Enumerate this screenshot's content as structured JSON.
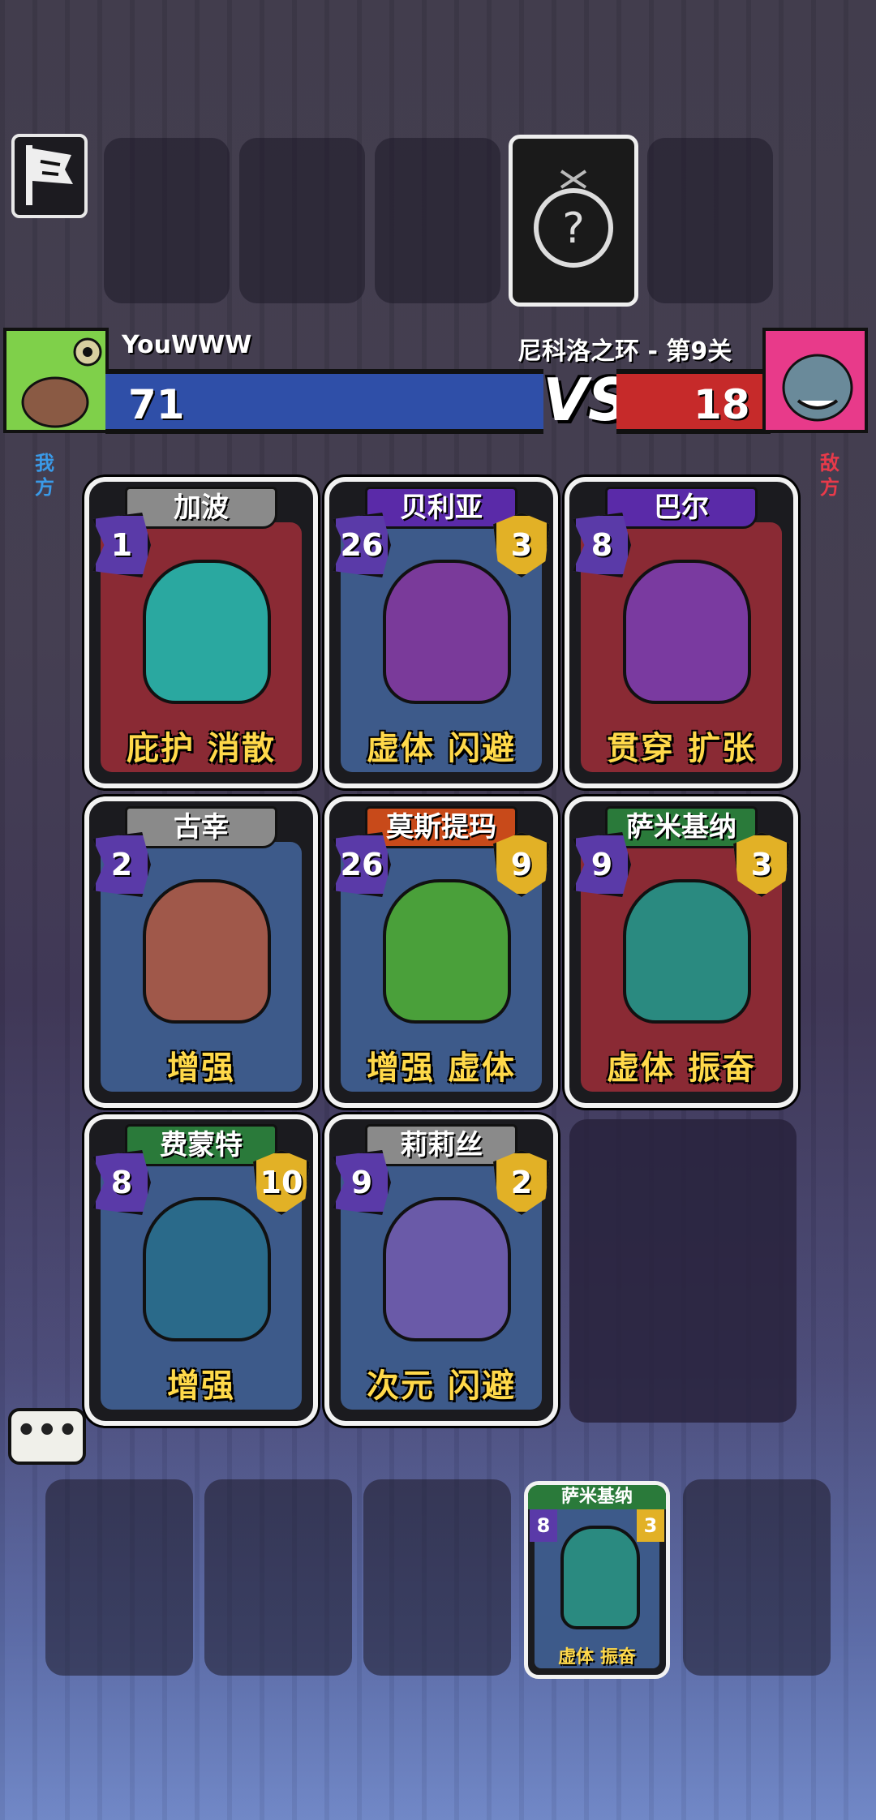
{
  "player": {
    "name": "YouWWW",
    "hp": "71",
    "side_label": "我方",
    "color": "#2f4fa8"
  },
  "enemy": {
    "name": "尼科洛之环 - 第9关",
    "hp": "18",
    "side_label": "敌方",
    "color": "#c62a2a"
  },
  "vs_label": "VS",
  "chat_label": "•••",
  "cards": [
    {
      "name": "加波",
      "attack": "1",
      "defense": "",
      "keywords": "庇护  消散",
      "banner": "#8a8a8a",
      "art": "#8a2a34",
      "monster": "#2aa8a0"
    },
    {
      "name": "贝利亚",
      "attack": "26",
      "defense": "3",
      "keywords": "虚体  闪避",
      "banner": "#5a2aa8",
      "art": "#3d5a8a",
      "monster": "#7a3a9a"
    },
    {
      "name": "巴尔",
      "attack": "8",
      "defense": "",
      "keywords": "贯穿  扩张",
      "banner": "#5a2aa8",
      "art": "#8a2a34",
      "monster": "#7a3aa0"
    },
    {
      "name": "古幸",
      "attack": "2",
      "defense": "",
      "keywords": "增强",
      "banner": "#8a8a8a",
      "art": "#3d5a8a",
      "monster": "#a0584a"
    },
    {
      "name": "莫斯提玛",
      "attack": "26",
      "defense": "9",
      "keywords": "增强  虚体",
      "banner": "#c84a1a",
      "art": "#3d5a8a",
      "monster": "#4aa03a"
    },
    {
      "name": "萨米基纳",
      "attack": "9",
      "defense": "3",
      "keywords": "虚体  振奋",
      "banner": "#2a7a3a",
      "art": "#8a2a34",
      "monster": "#2a8a80"
    },
    {
      "name": "费蒙特",
      "attack": "8",
      "defense": "10",
      "keywords": "增强",
      "banner": "#2a7a3a",
      "art": "#3d5a8a",
      "monster": "#2a6a8a"
    },
    {
      "name": "莉莉丝",
      "attack": "9",
      "defense": "2",
      "keywords": "次元  闪避",
      "banner": "#8a8a8a",
      "art": "#3d5a8a",
      "monster": "#6a5aa8"
    }
  ],
  "hand_card": {
    "name": "萨米基纳",
    "attack": "8",
    "defense": "3",
    "keywords": "虚体  振奋"
  }
}
